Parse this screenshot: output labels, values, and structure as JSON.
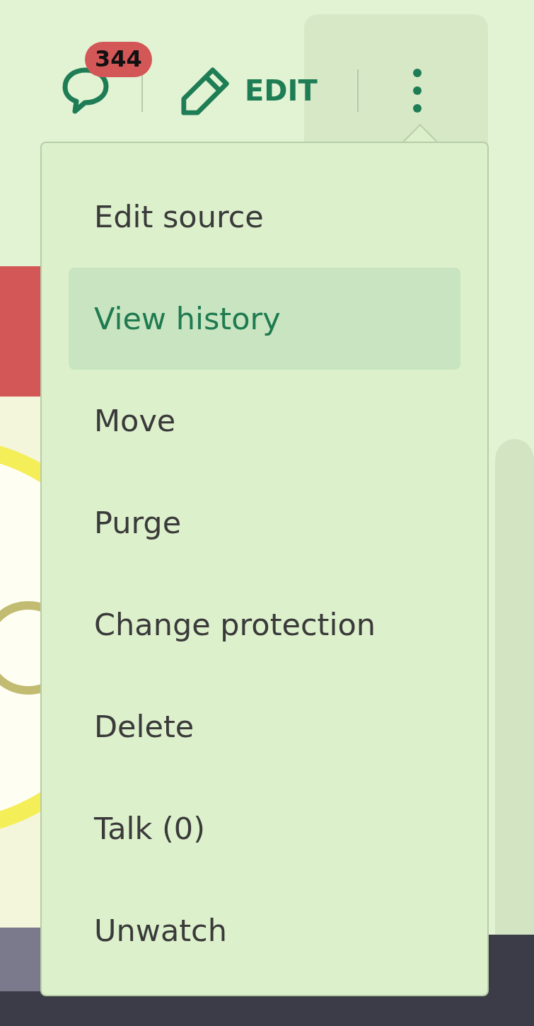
{
  "toolbar": {
    "talk_badge": "344",
    "edit_label": "EDIT"
  },
  "menu": {
    "items": [
      {
        "label": "Edit source",
        "selected": false
      },
      {
        "label": "View history",
        "selected": true
      },
      {
        "label": "Move",
        "selected": false
      },
      {
        "label": "Purge",
        "selected": false
      },
      {
        "label": "Change protection",
        "selected": false
      },
      {
        "label": "Delete",
        "selected": false
      },
      {
        "label": "Talk (0)",
        "selected": false
      },
      {
        "label": "Unwatch",
        "selected": false
      }
    ]
  }
}
